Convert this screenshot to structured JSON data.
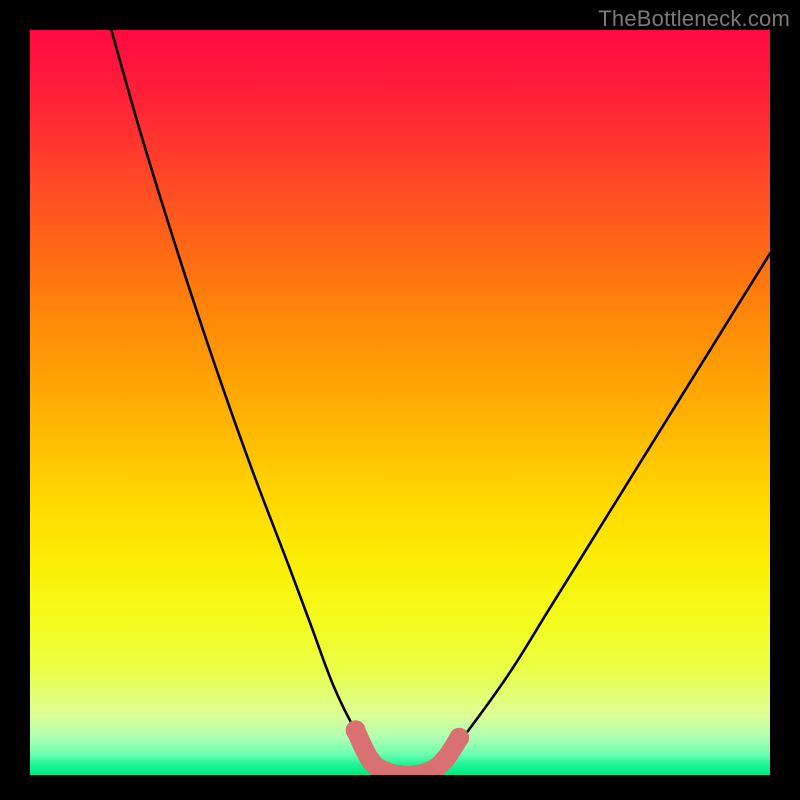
{
  "watermark": "TheBottleneck.com",
  "chart_data": {
    "type": "line",
    "title": "",
    "xlabel": "",
    "ylabel": "",
    "xlim": [
      0,
      100
    ],
    "ylim": [
      0,
      100
    ],
    "grid": false,
    "legend": false,
    "series": [
      {
        "name": "bottleneck-curve",
        "color": "#000000",
        "x": [
          11,
          15,
          20,
          25,
          30,
          35,
          38,
          41,
          44,
          47,
          50,
          53,
          56,
          60,
          65,
          70,
          75,
          80,
          85,
          90,
          95,
          100
        ],
        "y": [
          100,
          86,
          70,
          55,
          41,
          28,
          20,
          12,
          6,
          2,
          0,
          0,
          2,
          7,
          14,
          22,
          30,
          38,
          46,
          54,
          62,
          70
        ]
      },
      {
        "name": "optimal-zone-marker",
        "color": "#d8716f",
        "x": [
          44,
          46,
          48,
          50,
          52,
          54,
          56,
          58
        ],
        "y": [
          6,
          2,
          0.5,
          0,
          0,
          0.5,
          2,
          5
        ]
      }
    ],
    "background_gradient": {
      "stops": [
        [
          0.0,
          "#ff0a41"
        ],
        [
          0.09,
          "#ff2138"
        ],
        [
          0.18,
          "#ff4029"
        ],
        [
          0.28,
          "#ff6318"
        ],
        [
          0.37,
          "#ff830a"
        ],
        [
          0.46,
          "#ff9f04"
        ],
        [
          0.55,
          "#ffbc02"
        ],
        [
          0.63,
          "#ffd800"
        ],
        [
          0.72,
          "#fbef05"
        ],
        [
          0.8,
          "#f3fc20"
        ],
        [
          0.86,
          "#eaff4a"
        ],
        [
          0.92,
          "#dcff97"
        ],
        [
          0.95,
          "#aeffb4"
        ],
        [
          0.972,
          "#6bffb0"
        ],
        [
          0.985,
          "#23f596"
        ],
        [
          1.0,
          "#00e983"
        ]
      ]
    }
  }
}
